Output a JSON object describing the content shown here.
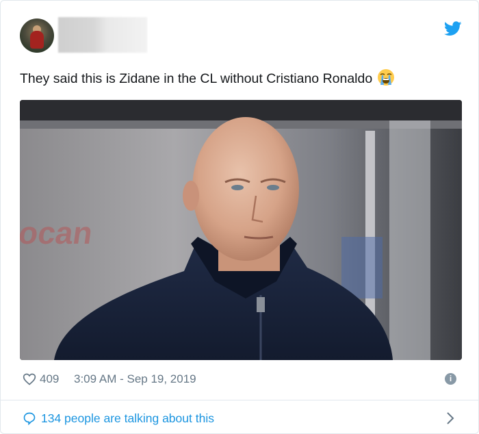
{
  "tweet": {
    "text": "They said this is Zidane in the CL without Cristiano Ronaldo",
    "emoji": "loudly-crying-face-emoji"
  },
  "meta": {
    "likes": "409",
    "timestamp": "3:09 AM - Sep 19, 2019",
    "info_icon": "i"
  },
  "footer": {
    "talking": "134 people are talking about this"
  },
  "colors": {
    "twitter_blue": "#1da1f2",
    "link_blue": "#1b95e0",
    "muted_gray": "#657786",
    "border": "#e1e8ed"
  }
}
